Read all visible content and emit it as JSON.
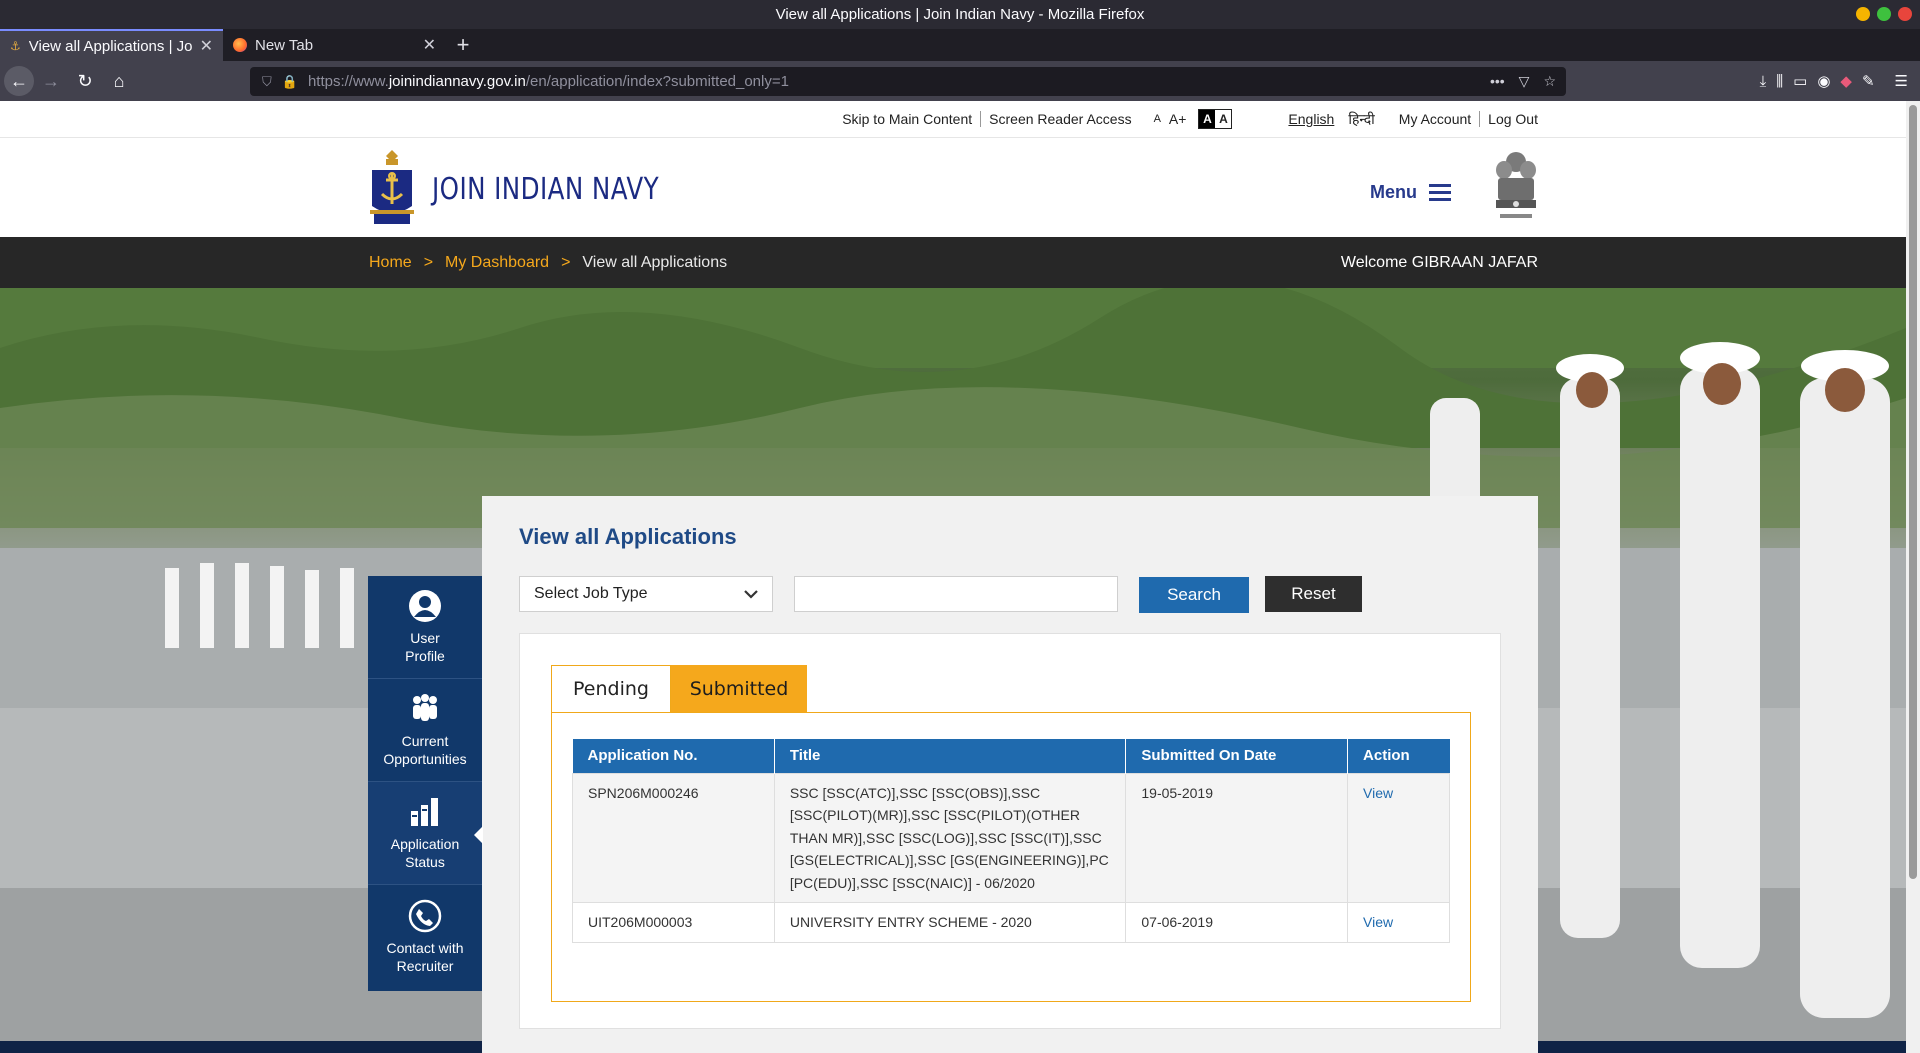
{
  "window": {
    "title": "View all Applications | Join Indian Navy - Mozilla Firefox"
  },
  "tabs": [
    {
      "title": "View all Applications | Join Indian Navy"
    },
    {
      "title": "New Tab"
    }
  ],
  "urlbar": {
    "prefix": "https://www.",
    "domain": "joinindiannavy.gov.in",
    "path": "/en/application/index?submitted_only=1"
  },
  "topbar": {
    "skip": "Skip to Main Content",
    "screen_reader": "Screen Reader Access",
    "font_small": "A",
    "font_large": "A+",
    "contrast_dark": "A",
    "contrast_light": "A",
    "lang_en": "English",
    "lang_hi": "हिन्दी",
    "my_account": "My Account",
    "logout": "Log Out"
  },
  "header": {
    "brand": "JOIN INDIAN NAVY",
    "menu": "Menu"
  },
  "breadcrumb": {
    "home": "Home",
    "dashboard": "My Dashboard",
    "current": "View all Applications",
    "separator": ">",
    "welcome": "Welcome GIBRAAN JAFAR"
  },
  "sidebar": {
    "items": [
      {
        "label1": "User",
        "label2": "Profile",
        "icon": "user-icon"
      },
      {
        "label1": "Current",
        "label2": "Opportunities",
        "icon": "people-icon"
      },
      {
        "label1": "Application",
        "label2": "Status",
        "icon": "bar-chart-icon"
      },
      {
        "label1": "Contact with",
        "label2": "Recruiter",
        "icon": "phone-icon"
      }
    ]
  },
  "main": {
    "title": "View all Applications",
    "select_placeholder": "Select Job Type",
    "search_label": "Search",
    "reset_label": "Reset",
    "tab_pending": "Pending",
    "tab_submitted": "Submitted"
  },
  "table": {
    "headers": [
      "Application No.",
      "Title",
      "Submitted On Date",
      "Action"
    ],
    "rows": [
      {
        "app_no": "SPN206M000246",
        "title": "SSC [SSC(ATC)],SSC [SSC(OBS)],SSC [SSC(PILOT)(MR)],SSC [SSC(PILOT)(OTHER THAN MR)],SSC [SSC(LOG)],SSC [SSC(IT)],SSC [GS(ELECTRICAL)],SSC [GS(ENGINEERING)],PC [PC(EDU)],SSC [SSC(NAIC)] - 06/2020",
        "date": "19-05-2019",
        "action": "View"
      },
      {
        "app_no": "UIT206M000003",
        "title": "UNIVERSITY ENTRY SCHEME - 2020",
        "date": "07-06-2019",
        "action": "View"
      }
    ]
  },
  "colors": {
    "navy": "#11386a",
    "accent_orange": "#f5a81c",
    "table_header": "#1f6aae",
    "brand_text": "#1b2a82"
  }
}
